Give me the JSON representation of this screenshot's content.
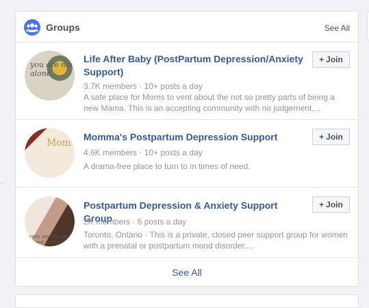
{
  "groups_card": {
    "title": "Groups",
    "header_see_all": "See All",
    "footer_see_all": "See All",
    "icon": "groups-icon",
    "groups": [
      {
        "name": "Life After Baby (PostPartum Depression/Anxiety Support)",
        "meta": "3.7K members · 10+ posts a day",
        "description": "A safe place for Moms to vent about the not so pretty parts of being a new Mama. This is an accepting community with no judgement,...",
        "join_label": "Join",
        "thumb_text": "you are not alone."
      },
      {
        "name": "Momma's Postpartum Depression Support",
        "meta": "4.6K members · 10+ posts a day",
        "description": "A drama-free place to turn to in times of need.",
        "join_label": "Join",
        "thumb_text": "Mom"
      },
      {
        "name": "Postpartum Depression & Anxiety Support Group",
        "meta": "2K members · 6 posts a day",
        "description": "Toronto, Ontario · This is a private, closed peer support group for women with a prenatal or postpartum mood disorder....",
        "join_label": "Join",
        "thumb_text": "xiety are the most ty and postpart"
      }
    ]
  }
}
